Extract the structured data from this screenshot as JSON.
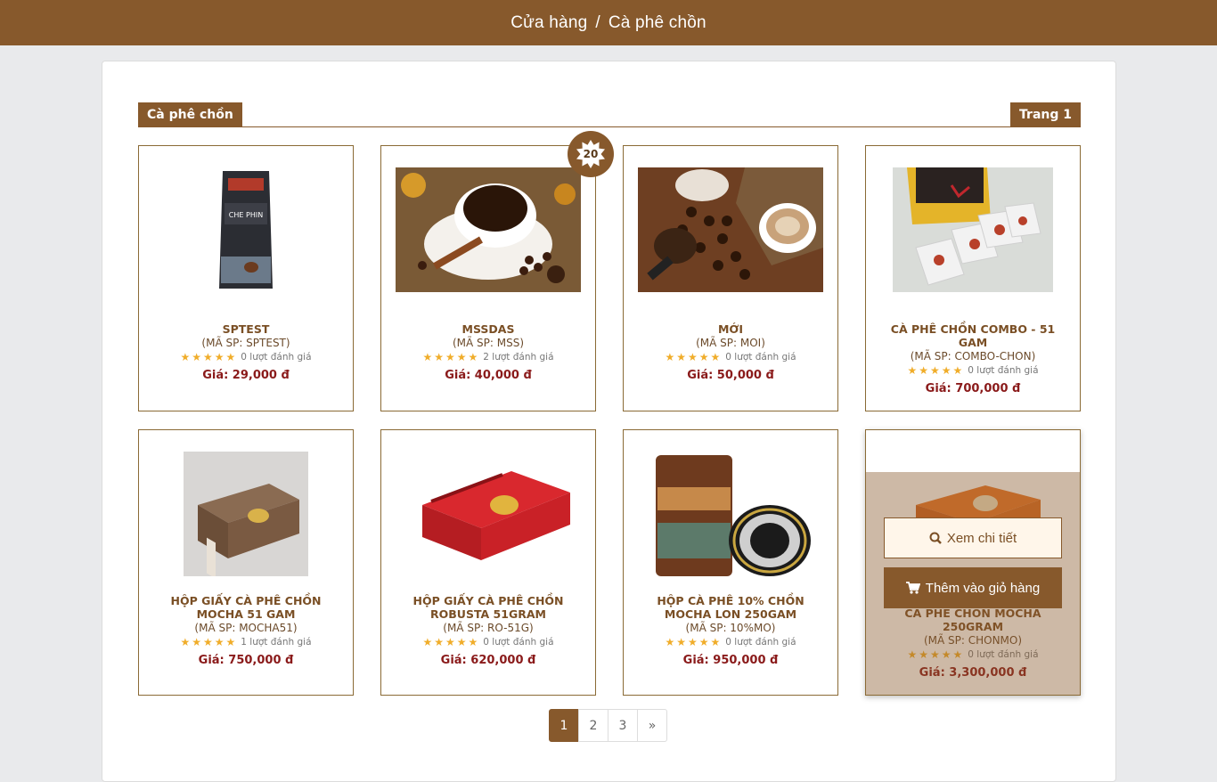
{
  "breadcrumb": {
    "home": "Cửa hàng",
    "separator": "/",
    "current": "Cà phê chồn"
  },
  "section": {
    "title": "Cà phê chồn",
    "page_label": "Trang 1"
  },
  "badge": {
    "value": "20"
  },
  "products": [
    {
      "name": "SPTEST",
      "code": "(MÃ SP: SPTEST)",
      "stars": "★★★★★",
      "rating_count": "0 lượt đánh giá",
      "price": "Giá: 29,000 đ",
      "image_icon": "coffee-bag-image"
    },
    {
      "name": "MSSDAS",
      "code": "(MÃ SP: MSS)",
      "stars": "★★★★★",
      "rating_count": "2 lượt đánh giá",
      "price": "Giá: 40,000 đ",
      "image_icon": "coffee-cup-image"
    },
    {
      "name": "MỚI",
      "code": "(MÃ SP: MOI)",
      "stars": "★★★★★",
      "rating_count": "0 lượt đánh giá",
      "price": "Giá: 50,000 đ",
      "image_icon": "coffee-beans-image"
    },
    {
      "name": "CÀ PHÊ CHỒN COMBO - 51 GAM",
      "code": "(MÃ SP: COMBO-CHON)",
      "stars": "★★★★★",
      "rating_count": "0 lượt đánh giá",
      "price": "Giá: 700,000 đ",
      "image_icon": "gift-box-image"
    },
    {
      "name": "HỘP GIẤY CÀ PHÊ CHỒN MOCHA 51 GAM",
      "code": "(MÃ SP: MOCHA51)",
      "stars": "★★★★★",
      "rating_count": "1 lượt đánh giá",
      "price": "Giá: 750,000 đ",
      "image_icon": "brown-box-image"
    },
    {
      "name": "HỘP GIẤY CÀ PHÊ CHỒN ROBUSTA 51GRAM",
      "code": "(MÃ SP: RO-51G)",
      "stars": "★★★★★",
      "rating_count": "0 lượt đánh giá",
      "price": "Giá: 620,000 đ",
      "image_icon": "red-box-image"
    },
    {
      "name": "HỘP CÀ PHÊ 10% CHỒN MOCHA LON 250GAM",
      "code": "(MÃ SP: 10%MO)",
      "stars": "★★★★★",
      "rating_count": "0 lượt đánh giá",
      "price": "Giá: 950,000 đ",
      "image_icon": "coffee-can-image"
    },
    {
      "name": "CÀ PHÊ CHỒN MOCHA 250GRAM",
      "code": "(MÃ SP: CHONMO)",
      "stars": "★★★★★",
      "rating_count": "0 lượt đánh giá",
      "price": "Giá: 3,300,000 đ",
      "image_icon": "orange-box-image"
    }
  ],
  "hover_actions": {
    "detail": "Xem chi tiết",
    "add_to_cart": "Thêm vào giỏ hàng"
  },
  "pagination": {
    "pages": [
      "1",
      "2",
      "3"
    ],
    "next": "»",
    "current": "1"
  },
  "colors": {
    "brand": "#87592c",
    "price": "#8a1a1a",
    "star": "#f0ad2a"
  }
}
